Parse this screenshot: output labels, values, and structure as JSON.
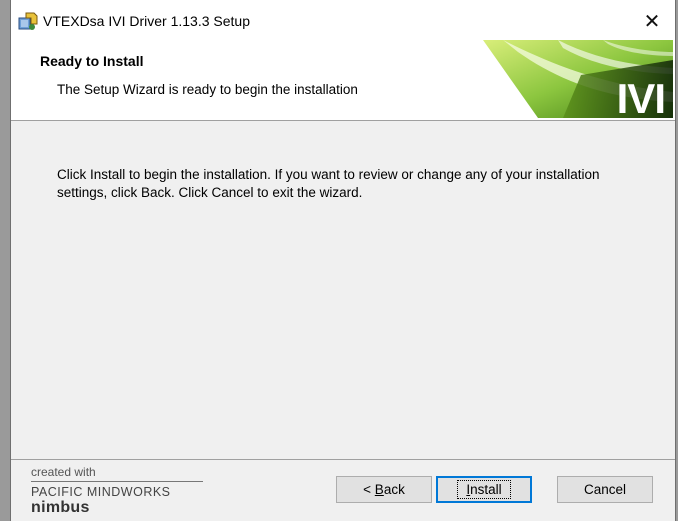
{
  "window": {
    "title": "VTEXDsa IVI Driver 1.13.3 Setup",
    "close_glyph": "✕"
  },
  "header": {
    "title": "Ready to Install",
    "subtitle": "The Setup Wizard is ready to begin the  installation",
    "banner_text": "IVI"
  },
  "content": {
    "message": "Click Install to begin the installation.  If you want to review or change any of your installation settings, click Back.  Click Cancel to exit the wizard."
  },
  "footer": {
    "created_with": "created with",
    "company": "PACIFIC MINDWORKS",
    "product": "nimbus"
  },
  "buttons": {
    "back_prefix": "< ",
    "back_mnemonic": "B",
    "back_rest": "ack",
    "install_mnemonic": "I",
    "install_rest": "nstall",
    "cancel": "Cancel"
  },
  "colors": {
    "banner_green": "#7dbb1f",
    "banner_dark": "#1f3a10",
    "focus_blue": "#0078d7"
  },
  "icons": {
    "app": "setup-package-icon",
    "close": "close-icon"
  }
}
